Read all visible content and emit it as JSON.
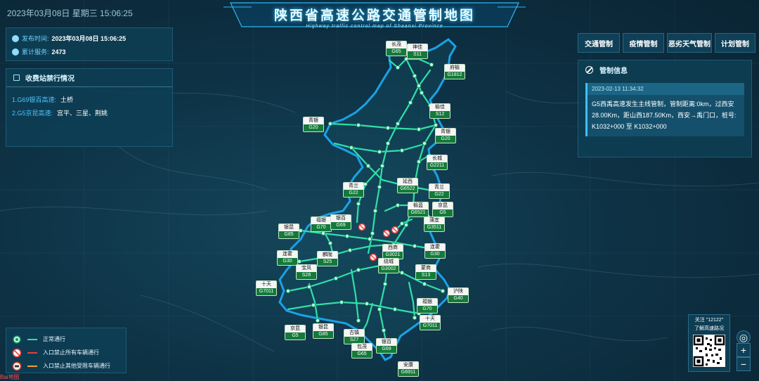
{
  "header": {
    "datetime": "2023年03月08日 星期三 15:06:25",
    "title": "陕西省高速公路交通管制地图",
    "subtitle": "Highway traffic control map of Shaanxi Province"
  },
  "info": {
    "publish_label": "发布时间:",
    "publish_value": "2023年03月08日 15:06:25",
    "service_label": "累计服务:",
    "service_value": "2473"
  },
  "toll": {
    "title": "收费站禁行情况",
    "items": [
      {
        "road": "1.G69银百高速:",
        "stations": "土桥"
      },
      {
        "road": "2.G5京昆高速:",
        "stations": "宫平、三星、荆姚"
      }
    ]
  },
  "tabs": [
    {
      "label": "交通管制"
    },
    {
      "label": "疫情管制"
    },
    {
      "label": "恶劣天气管制"
    },
    {
      "label": "计划管制"
    }
  ],
  "control": {
    "title": "管制信息",
    "time": "2023-02-13 11:34:32",
    "text": "G5西禹高速发生主线管制，管制距离:0km，过西安28.00Km，距山西187.50Km，西安→禹门口，桩号: K1032+000 至 K1032+000"
  },
  "legend": [
    {
      "label": "正常通行",
      "icon": "normal-node-icon",
      "color": "#2fe0a8"
    },
    {
      "label": "入口禁止所有车辆通行",
      "icon": "no-entry-icon",
      "color": "#e8403c"
    },
    {
      "label": "入口禁止其他受限车辆通行",
      "icon": "restricted-entry-icon",
      "color": "#f0a23a"
    }
  ],
  "signs": [
    {
      "name": "长茂",
      "code": "G65"
    },
    {
      "name": "神佳",
      "code": "S11"
    },
    {
      "name": "府榆",
      "code": "G1812"
    },
    {
      "name": "榆佳",
      "code": "S12"
    },
    {
      "name": "青银",
      "code": "G20"
    },
    {
      "name": "青银",
      "code": "G20"
    },
    {
      "name": "长城",
      "code": "G2211"
    },
    {
      "name": "青兰",
      "code": "G22"
    },
    {
      "name": "延西",
      "code": "G6522"
    },
    {
      "name": "青兰",
      "code": "G22"
    },
    {
      "name": "榆蓝",
      "code": "G6521"
    },
    {
      "name": "京昆",
      "code": "G5"
    },
    {
      "name": "银昆",
      "code": "G85"
    },
    {
      "name": "福银",
      "code": "G70"
    },
    {
      "name": "银百",
      "code": "G69"
    },
    {
      "name": "蒲宜",
      "code": "G3511"
    },
    {
      "name": "连霍",
      "code": "G30"
    },
    {
      "name": "西商",
      "code": "G3021"
    },
    {
      "name": "连霍",
      "code": "G30"
    },
    {
      "name": "麟陇",
      "code": "S25"
    },
    {
      "name": "宝凤",
      "code": "S28"
    },
    {
      "name": "绕城",
      "code": "G3002"
    },
    {
      "name": "沪陕",
      "code": "G40"
    },
    {
      "name": "蒙商",
      "code": "S13"
    },
    {
      "name": "十天",
      "code": "G7011"
    },
    {
      "name": "福银",
      "code": "G70"
    },
    {
      "name": "十天",
      "code": "G7011"
    },
    {
      "name": "京昆",
      "code": "G5"
    },
    {
      "name": "银昆",
      "code": "G85"
    },
    {
      "name": "古镇",
      "code": "S27"
    },
    {
      "name": "包茂",
      "code": "G65"
    },
    {
      "name": "银百",
      "code": "G69"
    },
    {
      "name": "安康",
      "code": "G6911"
    }
  ],
  "qr": {
    "note_line1": "关注 \"12122\"",
    "note_line2": "了解高速路况"
  },
  "map_controls": {
    "locate": "◎",
    "zoom_in": "+",
    "zoom_out": "−"
  },
  "brand": "Bai地图"
}
